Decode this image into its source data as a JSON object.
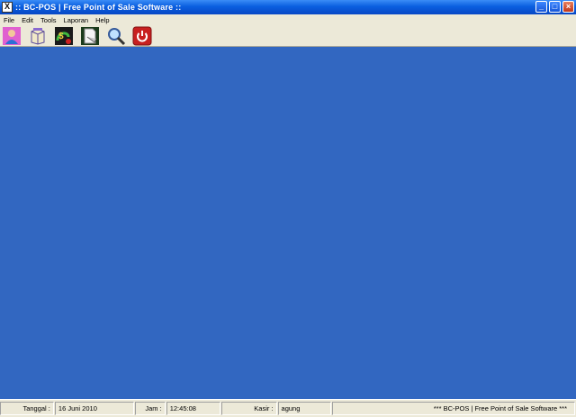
{
  "window": {
    "title": ":: BC-POS  |  Free Point of Sale Software ::",
    "controls": [
      "_",
      "□",
      "×"
    ]
  },
  "menu": [
    "File",
    "Edit",
    "Tools",
    "Laporan",
    "Help"
  ],
  "toolbar": {
    "items": [
      "user-icon",
      "box-icon",
      "sales-icon",
      "document-icon",
      "magnifier-icon",
      "power-icon"
    ]
  },
  "statusbar": {
    "tanggal_label": "Tanggal :",
    "tanggal_value": "16 Juni 2010",
    "jam_label": "Jam :",
    "jam_value": "12:45:08",
    "kasir_label": "Kasir :",
    "kasir_value": "agung",
    "footer": "*** BC-POS | Free Point of Sale Software ***"
  },
  "colors": {
    "workspace": "#3267c1",
    "titlebar": "#0a5fe0",
    "chrome": "#ece9d8"
  }
}
